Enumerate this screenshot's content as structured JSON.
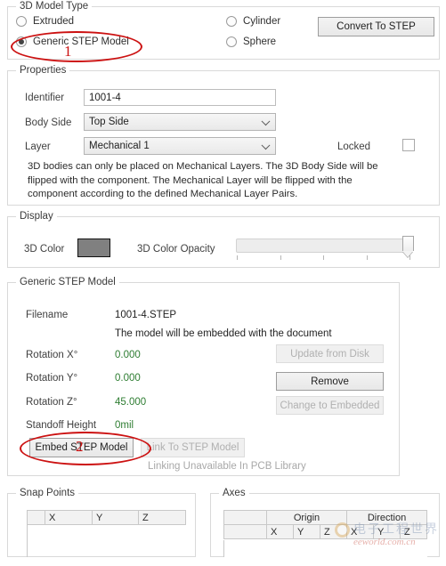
{
  "model_type": {
    "title": "3D Model Type",
    "options": [
      {
        "label": "Extruded",
        "checked": false
      },
      {
        "label": "Generic STEP Model",
        "checked": true
      },
      {
        "label": "Cylinder",
        "checked": false
      },
      {
        "label": "Sphere",
        "checked": false
      }
    ],
    "convert_button": "Convert To STEP"
  },
  "properties": {
    "title": "Properties",
    "identifier_label": "Identifier",
    "identifier_value": "1001-4",
    "body_side_label": "Body Side",
    "body_side_value": "Top Side",
    "layer_label": "Layer",
    "layer_value": "Mechanical 1",
    "locked_label": "Locked",
    "locked_checked": false,
    "help_text": "3D bodies can only be placed on Mechanical Layers. The 3D Body Side will be flipped with the component. The Mechanical Layer will be flipped with the component according to the defined Mechanical Layer Pairs."
  },
  "display": {
    "title": "Display",
    "color_label": "3D Color",
    "color_value": "#808080",
    "opacity_label": "3D Color Opacity",
    "opacity_percent": 100
  },
  "step_model": {
    "title": "Generic STEP Model",
    "filename_label": "Filename",
    "filename_value": "1001-4.STEP",
    "embed_note": "The model will be embedded with the document",
    "rotation_x_label": "Rotation X°",
    "rotation_x_value": "0.000",
    "rotation_y_label": "Rotation Y°",
    "rotation_y_value": "0.000",
    "rotation_z_label": "Rotation Z°",
    "rotation_z_value": "45.000",
    "standoff_label": "Standoff Height",
    "standoff_value": "0mil",
    "update_button": "Update from Disk",
    "remove_button": "Remove",
    "change_button": "Change to Embedded",
    "embed_button": "Embed STEP Model",
    "link_button": "Link To STEP Model",
    "link_note": "Linking Unavailable In PCB Library"
  },
  "snap_points": {
    "title": "Snap Points",
    "columns": [
      "",
      "X",
      "Y",
      "Z"
    ]
  },
  "axes": {
    "title": "Axes",
    "group_headers": [
      "",
      "Origin",
      "Direction"
    ],
    "sub_headers": [
      "",
      "X",
      "Y",
      "Z",
      "X",
      "Y",
      "Z"
    ]
  },
  "annotations": [
    {
      "number": "1"
    },
    {
      "number": "2"
    }
  ],
  "watermark": {
    "chinese": "电子工程世界",
    "url": "eeworld.com.cn"
  }
}
